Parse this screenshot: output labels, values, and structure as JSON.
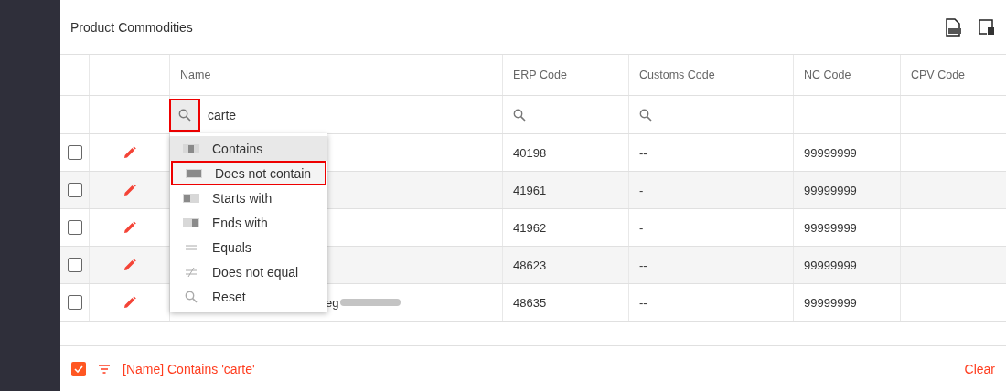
{
  "title": "Product Commodities",
  "columns": [
    {},
    {},
    {
      "label": "Name"
    },
    {
      "label": "ERP Code"
    },
    {
      "label": "Customs Code"
    },
    {
      "label": "NC Code"
    },
    {
      "label": "CPV Code"
    }
  ],
  "filter": {
    "value": "carte",
    "search_highlighted": true
  },
  "rows": [
    {
      "checked": false,
      "erp": "40198",
      "customs": "--",
      "nc": "99999999"
    },
    {
      "checked": false,
      "erp": "41961",
      "customs": "-",
      "nc": "99999999"
    },
    {
      "checked": false,
      "erp": "41962",
      "customs": "-",
      "nc": "99999999"
    },
    {
      "checked": false,
      "erp": "48623",
      "customs": "--",
      "nc": "99999999"
    },
    {
      "checked": false,
      "name": "eg",
      "erp": "48635",
      "customs": "--",
      "nc": "99999999"
    }
  ],
  "menu": [
    {
      "kind": "contains",
      "label": "Contains",
      "selected": true,
      "highlighted": false
    },
    {
      "kind": "notcontains",
      "label": "Does not contain",
      "selected": false,
      "highlighted": true
    },
    {
      "kind": "starts",
      "label": "Starts with",
      "selected": false,
      "highlighted": false
    },
    {
      "kind": "ends",
      "label": "Ends with",
      "selected": false,
      "highlighted": false
    },
    {
      "kind": "equals",
      "label": "Equals",
      "selected": false,
      "highlighted": false
    },
    {
      "kind": "notequal",
      "label": "Does not equal",
      "selected": false,
      "highlighted": false
    },
    {
      "kind": "reset",
      "label": "Reset",
      "selected": false,
      "highlighted": false
    }
  ],
  "footer": {
    "checked": true,
    "filter_text": "[Name] Contains 'carte'",
    "clear": "Clear"
  }
}
